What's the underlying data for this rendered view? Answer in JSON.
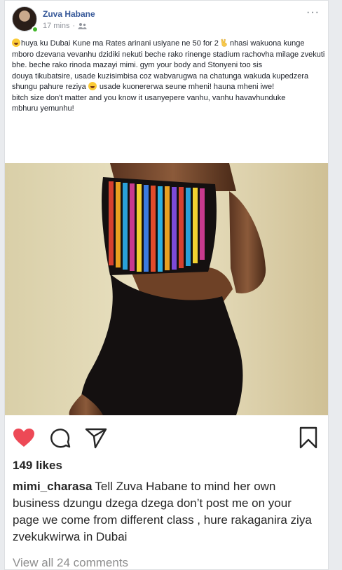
{
  "post": {
    "author": "Zuva Habane",
    "time": "17 mins",
    "separator": "·",
    "audience_icon": "friends-icon",
    "text_lines": [
      "huya ku Dubai Kune ma Rates arinani usiyane ne 50 for 2",
      "nhasi wakuona kunge mboro dzevana vevanhu dzidiki nekuti beche rako rinenge stadium rachovha milage zvekuti bhe. beche rako rinoda mazayi mimi. gym your body and Stonyeni too sis",
      "douya tikubatsire, usade kuzisimbisa coz wabvarugwa na chatunga wakuda kupedzera shungu pahure reziya",
      "usade kuonerегwa seune mheni! hauna mheni iwe!",
      "bitch size don't matter and you know it usanyepere vanhu, vanhu havavhunduke",
      "mbhuru yemunhu!"
    ]
  },
  "instagram": {
    "likes": "149 likes",
    "caption_user": "mimi_charasa",
    "caption_text": "Tell Zuva Habane to mind her own business dzungu dzega dzega don’t post me on your page we  come from different class , hure rakaganira ziya zvekukwirwa in Dubai",
    "view_comments": "View all 24 comments"
  },
  "colors": {
    "link": "#365899",
    "heart": "#ed4956",
    "online": "#42b72a"
  }
}
